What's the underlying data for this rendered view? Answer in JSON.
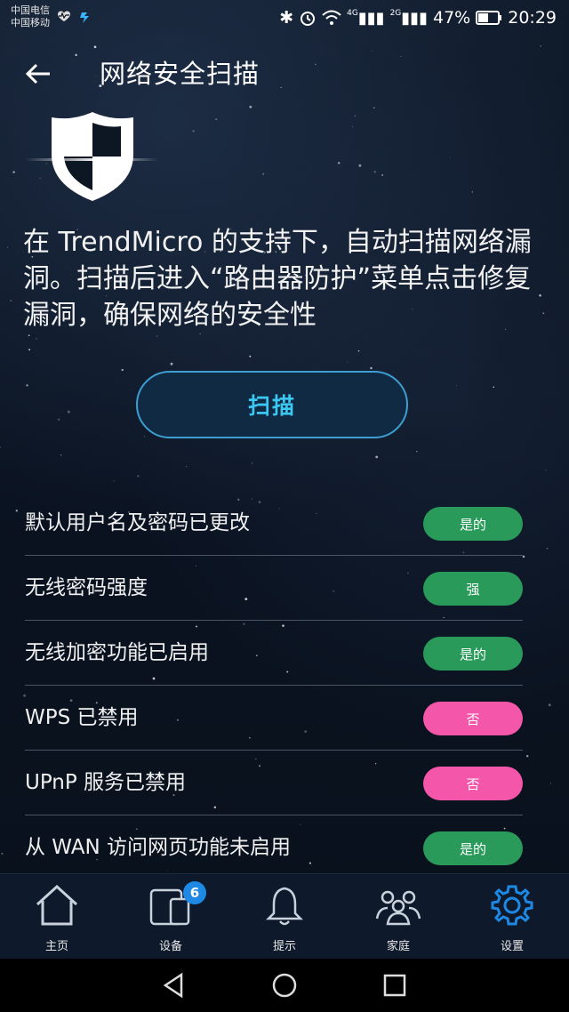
{
  "status_bar": {
    "carrier_1": "中国电信",
    "carrier_2": "中国移动",
    "net_1": "4G",
    "net_2": "2G",
    "battery": "47%",
    "time": "20:29"
  },
  "header": {
    "title": "网络安全扫描",
    "back_icon": "back-arrow-icon"
  },
  "description": "在 TrendMicro 的支持下，自动扫描网络漏洞。扫描后进入“路由器防护”菜单点击修复漏洞，确保网络的安全性",
  "scan_button": "扫描",
  "results": [
    {
      "label": "默认用户名及密码已更改",
      "status": "是的",
      "type": "yes"
    },
    {
      "label": "无线密码强度",
      "status": "强",
      "type": "yes"
    },
    {
      "label": "无线加密功能已启用",
      "status": "是的",
      "type": "yes"
    },
    {
      "label": "WPS 已禁用",
      "status": "否",
      "type": "no"
    },
    {
      "label": "UPnP 服务已禁用",
      "status": "否",
      "type": "no"
    },
    {
      "label": "从 WAN 访问网页功能未启用",
      "status": "是的",
      "type": "yes"
    }
  ],
  "bottom_nav": [
    {
      "label": "主页",
      "icon": "home-icon"
    },
    {
      "label": "设备",
      "icon": "devices-icon",
      "badge": "6"
    },
    {
      "label": "提示",
      "icon": "bell-icon"
    },
    {
      "label": "家庭",
      "icon": "family-icon"
    },
    {
      "label": "设置",
      "icon": "gear-icon",
      "active": true
    }
  ],
  "colors": {
    "accent": "#3cc6f2",
    "yes": "#2a9a5a",
    "no": "#f456a9",
    "active_nav": "#1e88e5"
  }
}
